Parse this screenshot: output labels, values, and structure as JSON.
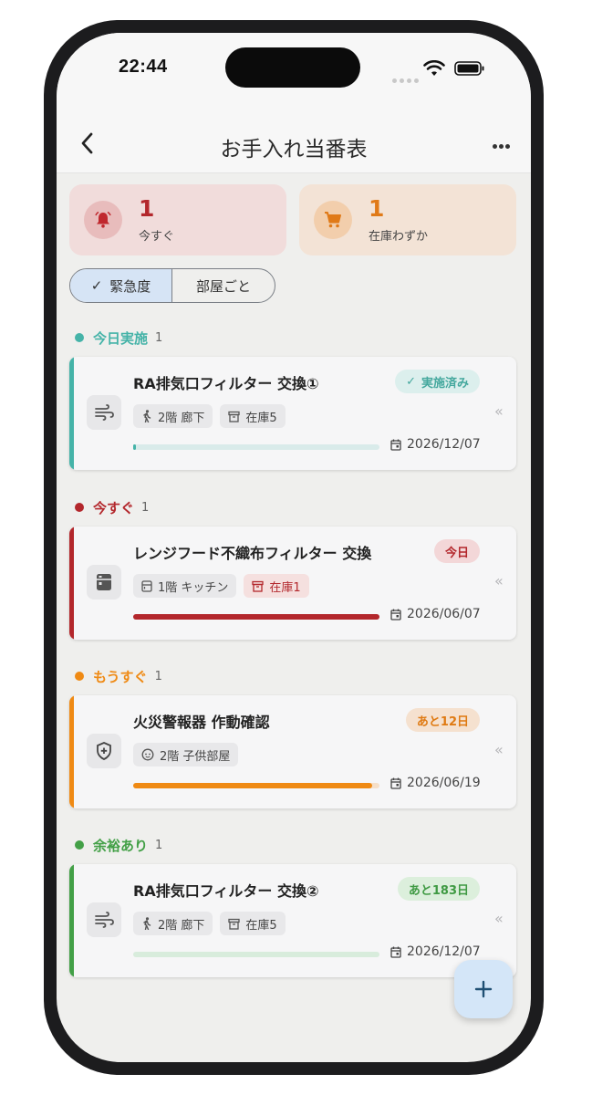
{
  "status": {
    "time": "22:44"
  },
  "nav": {
    "title": "お手入れ当番表"
  },
  "summary": [
    {
      "count": "1",
      "label": "今すぐ",
      "icon": "bell-icon",
      "color": "#b3272c"
    },
    {
      "count": "1",
      "label": "在庫わずか",
      "icon": "cart-icon",
      "color": "#e07a18"
    }
  ],
  "segments": [
    {
      "label": "緊急度",
      "selected": true
    },
    {
      "label": "部屋ごと",
      "selected": false
    }
  ],
  "sections": [
    {
      "name": "今日実施",
      "count": "1",
      "color": "#45b3a8",
      "card": {
        "title": "RA排気口フィルター 交換①",
        "badge": "実施済み",
        "badge_check": "✓",
        "icon": "air-vent-icon",
        "chips": [
          "2階 廊下",
          "在庫5"
        ],
        "progress": 0.01,
        "date": "2026/12/07"
      }
    },
    {
      "name": "今すぐ",
      "count": "1",
      "color": "#b3272c",
      "card": {
        "title": "レンジフード不織布フィルター 交換",
        "badge": "今日",
        "icon": "range-hood-icon",
        "chips": [
          "1階 キッチン",
          "在庫1"
        ],
        "progress": 1.0,
        "date": "2026/06/07"
      }
    },
    {
      "name": "もうすぐ",
      "count": "1",
      "color": "#ef8a14",
      "card": {
        "title": "火災警報器 作動確認",
        "badge": "あと12日",
        "icon": "shield-plus-icon",
        "chips": [
          "2階 子供部屋"
        ],
        "progress": 0.97,
        "date": "2026/06/19"
      }
    },
    {
      "name": "余裕あり",
      "count": "1",
      "color": "#43a047",
      "card": {
        "title": "RA排気口フィルター 交換②",
        "badge": "あと183日",
        "icon": "air-vent-icon",
        "chips": [
          "2階 廊下",
          "在庫5"
        ],
        "progress": 0.0,
        "date": "2026/12/07"
      }
    }
  ],
  "swipe_hint": "«",
  "fab": {
    "label": "+"
  }
}
